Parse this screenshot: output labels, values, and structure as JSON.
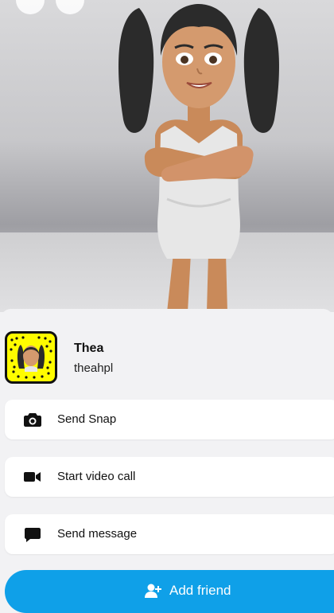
{
  "profile": {
    "display_name": "Thea",
    "username": "theahpl"
  },
  "actions": [
    {
      "label": "Send Snap",
      "icon": "camera-icon"
    },
    {
      "label": "Start video call",
      "icon": "video-camera-icon"
    },
    {
      "label": "Send message",
      "icon": "chat-bubble-icon"
    }
  ],
  "add_friend": {
    "label": "Add friend",
    "icon": "add-person-icon",
    "color": "#0fa0e8"
  },
  "colors": {
    "snapcode_yellow": "#fffc00",
    "sheet_background": "#f2f2f4"
  }
}
